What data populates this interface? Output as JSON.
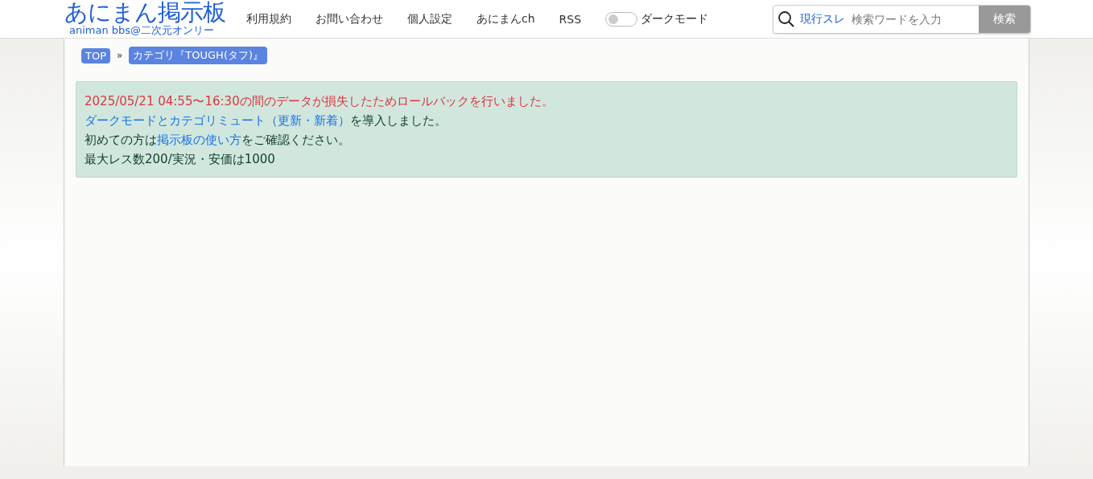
{
  "header": {
    "logo": {
      "title": "あにまん掲示板",
      "subtitle": "animan bbs@二次元オンリー"
    },
    "nav": [
      "利用規約",
      "お問い合わせ",
      "個人設定",
      "あにまんch",
      "RSS"
    ],
    "dark_mode": {
      "label": "ダークモード",
      "on": false
    },
    "search": {
      "scope": "現行スレ",
      "placeholder": "検索ワードを入力",
      "button": "検索"
    }
  },
  "breadcrumb": {
    "items": [
      "TOP",
      "カテゴリ『TOUGH(タフ)』"
    ],
    "separator": "»"
  },
  "notice": [
    {
      "kind": "alert",
      "parts": [
        {
          "kind": "text",
          "text": "2025/05/21 04:55〜16:30の間のデータが損失したためロールバックを行いました。"
        }
      ]
    },
    {
      "kind": "normal",
      "parts": [
        {
          "kind": "link",
          "text": "ダークモードとカテゴリミュート（更新・新着）"
        },
        {
          "kind": "text",
          "text": "を導入しました。"
        }
      ]
    },
    {
      "kind": "normal",
      "parts": [
        {
          "kind": "text",
          "text": "初めての方は"
        },
        {
          "kind": "link",
          "text": "掲示板の使い方"
        },
        {
          "kind": "text",
          "text": "をご確認ください。"
        }
      ]
    },
    {
      "kind": "normal",
      "parts": [
        {
          "kind": "text",
          "text": "最大レス数200/実況・安価は1000"
        }
      ]
    }
  ]
}
